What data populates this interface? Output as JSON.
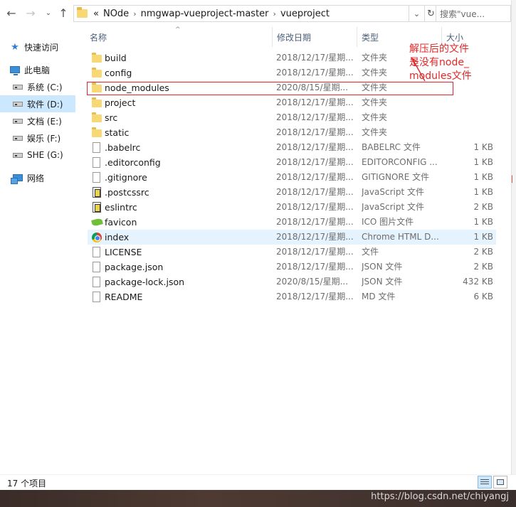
{
  "nav": {
    "back_icon": "back-arrow-icon",
    "forward_icon": "forward-arrow-icon",
    "dropdown_icon": "chevron-down-icon",
    "up_icon": "up-arrow-icon"
  },
  "address": {
    "overflow": "«",
    "crumbs": [
      "NOde",
      "nmgwap-vueproject-master",
      "vueproject"
    ],
    "separator": "›"
  },
  "search": {
    "placeholder": "搜索\"vue..."
  },
  "sidebar": {
    "items": [
      {
        "label": "快速访问",
        "icon": "star-icon",
        "selected": false
      },
      {
        "label": "此电脑",
        "icon": "computer-icon",
        "selected": false
      },
      {
        "label": "系统 (C:)",
        "icon": "drive-icon",
        "selected": false
      },
      {
        "label": "软件 (D:)",
        "icon": "drive-icon",
        "selected": true
      },
      {
        "label": "文档 (E:)",
        "icon": "drive-icon",
        "selected": false
      },
      {
        "label": "娱乐 (F:)",
        "icon": "drive-icon",
        "selected": false
      },
      {
        "label": "SHE (G:)",
        "icon": "drive-icon",
        "selected": false
      },
      {
        "label": "网络",
        "icon": "network-icon",
        "selected": false
      }
    ]
  },
  "columns": {
    "name": "名称",
    "date": "修改日期",
    "type": "类型",
    "size": "大小"
  },
  "files": [
    {
      "name": "build",
      "date": "2018/12/17/星期...",
      "type": "文件夹",
      "size": "",
      "icon": "folder"
    },
    {
      "name": "config",
      "date": "2018/12/17/星期...",
      "type": "文件夹",
      "size": "",
      "icon": "folder"
    },
    {
      "name": "node_modules",
      "date": "2020/8/15/星期...",
      "type": "文件夹",
      "size": "",
      "icon": "folder"
    },
    {
      "name": "project",
      "date": "2018/12/17/星期...",
      "type": "文件夹",
      "size": "",
      "icon": "folder"
    },
    {
      "name": "src",
      "date": "2018/12/17/星期...",
      "type": "文件夹",
      "size": "",
      "icon": "folder"
    },
    {
      "name": "static",
      "date": "2018/12/17/星期...",
      "type": "文件夹",
      "size": "",
      "icon": "folder"
    },
    {
      "name": ".babelrc",
      "date": "2018/12/17/星期...",
      "type": "BABELRC 文件",
      "size": "1 KB",
      "icon": "doc"
    },
    {
      "name": ".editorconfig",
      "date": "2018/12/17/星期...",
      "type": "EDITORCONFIG ...",
      "size": "1 KB",
      "icon": "doc"
    },
    {
      "name": ".gitignore",
      "date": "2018/12/17/星期...",
      "type": "GITIGNORE 文件",
      "size": "1 KB",
      "icon": "doc"
    },
    {
      "name": ".postcssrc",
      "date": "2018/12/17/星期...",
      "type": "JavaScript 文件",
      "size": "1 KB",
      "icon": "js"
    },
    {
      "name": "eslintrc",
      "date": "2018/12/17/星期...",
      "type": "JavaScript 文件",
      "size": "2 KB",
      "icon": "js"
    },
    {
      "name": "favicon",
      "date": "2018/12/17/星期...",
      "type": "ICO 图片文件",
      "size": "1 KB",
      "icon": "leaf"
    },
    {
      "name": "index",
      "date": "2018/12/17/星期...",
      "type": "Chrome HTML D...",
      "size": "1 KB",
      "icon": "chrome",
      "hover": true
    },
    {
      "name": "LICENSE",
      "date": "2018/12/17/星期...",
      "type": "文件",
      "size": "2 KB",
      "icon": "doc"
    },
    {
      "name": "package.json",
      "date": "2018/12/17/星期...",
      "type": "JSON 文件",
      "size": "2 KB",
      "icon": "doc"
    },
    {
      "name": "package-lock.json",
      "date": "2020/8/15/星期...",
      "type": "JSON 文件",
      "size": "432 KB",
      "icon": "doc"
    },
    {
      "name": "README",
      "date": "2018/12/17/星期...",
      "type": "MD 文件",
      "size": "6 KB",
      "icon": "doc"
    }
  ],
  "annotation": {
    "lines": [
      "解压后的文件",
      "是没有node_",
      "modules文件"
    ],
    "color": "#e02828"
  },
  "status": {
    "count": "17 个项目"
  },
  "view_buttons": {
    "details_icon": "details-view-icon",
    "tiles_icon": "large-icons-view-icon"
  },
  "watermark": "https://blog.csdn.net/chiyangj",
  "colors": {
    "selection": "#cce8ff",
    "hover": "#e5f3ff",
    "folder": "#f8d775",
    "accent": "#e02828"
  }
}
